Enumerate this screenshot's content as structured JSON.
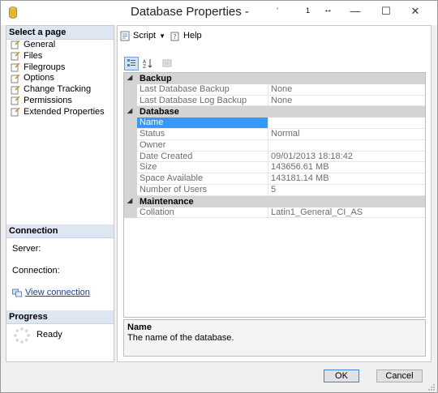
{
  "window": {
    "title": "Database Properties -",
    "title_glyphs": [
      "’",
      "1",
      "↔"
    ],
    "controls": {
      "minimize": "—",
      "maximize": "☐",
      "close": "✕"
    }
  },
  "left": {
    "select_page_header": "Select a page",
    "pages": [
      {
        "label": "General",
        "icon": "page-icon"
      },
      {
        "label": "Files",
        "icon": "page-icon"
      },
      {
        "label": "Filegroups",
        "icon": "page-icon"
      },
      {
        "label": "Options",
        "icon": "page-icon"
      },
      {
        "label": "Change Tracking",
        "icon": "page-icon"
      },
      {
        "label": "Permissions",
        "icon": "page-icon"
      },
      {
        "label": "Extended Properties",
        "icon": "page-icon"
      }
    ],
    "connection_header": "Connection",
    "server_label": "Server:",
    "connection_label": "Connection:",
    "view_connection": "View connection",
    "progress_header": "Progress",
    "progress_status": "Ready"
  },
  "toolbar": {
    "script_label": "Script",
    "help_label": "Help"
  },
  "grid": {
    "categories": [
      {
        "label": "Backup",
        "rows": [
          {
            "name": "Last Database Backup",
            "value": "None"
          },
          {
            "name": "Last Database Log Backup",
            "value": "None"
          }
        ]
      },
      {
        "label": "Database",
        "rows": [
          {
            "name": "Name",
            "value": ""
          },
          {
            "name": "Status",
            "value": "Normal"
          },
          {
            "name": "Owner",
            "value": ""
          },
          {
            "name": "Date Created",
            "value": "09/01/2013 18:18:42"
          },
          {
            "name": "Size",
            "value": "143656.61 MB"
          },
          {
            "name": "Space Available",
            "value": "143181.14 MB"
          },
          {
            "name": "Number of Users",
            "value": "5"
          }
        ]
      },
      {
        "label": "Maintenance",
        "rows": [
          {
            "name": "Collation",
            "value": "Latin1_General_CI_AS"
          }
        ]
      }
    ],
    "selected_row": "Name"
  },
  "description": {
    "title": "Name",
    "text": "The name of the database."
  },
  "buttons": {
    "ok": "OK",
    "cancel": "Cancel"
  },
  "colors": {
    "selection": "#3399ff",
    "section_header": "#dde6f1",
    "category_bg": "#d4d4d4",
    "link": "#1a3fa8"
  }
}
